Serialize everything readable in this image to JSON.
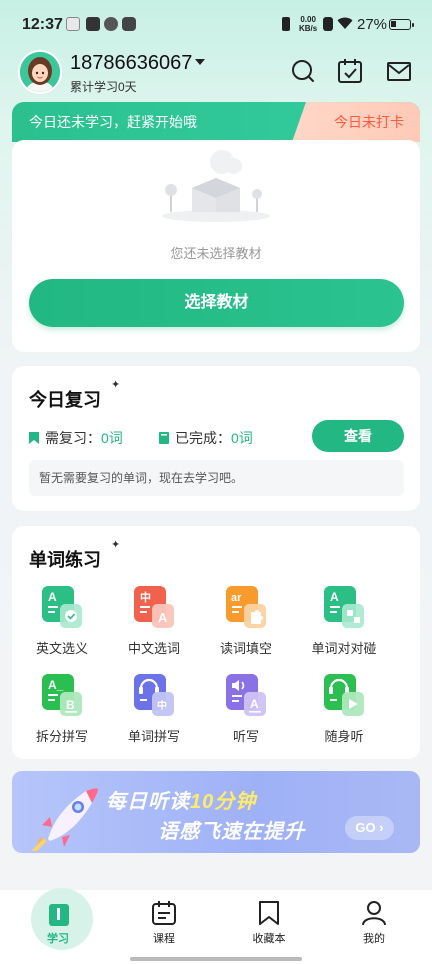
{
  "status_bar": {
    "time": "12:37",
    "net_speed_value": "0.00",
    "net_speed_unit": "KB/s",
    "battery_percent": "27%"
  },
  "header": {
    "phone": "18786636067",
    "study_days": "累计学习0天",
    "icons": [
      "search-icon",
      "calendar-check-icon",
      "mail-icon"
    ]
  },
  "textbook": {
    "banner_left": "今日还未学习，赶紧开始哦",
    "banner_right": "今日未打卡",
    "empty_text": "您还未选择教材",
    "select_button": "选择教材"
  },
  "review": {
    "title": "今日复习",
    "need_label": "需复习：",
    "need_value": "0词",
    "done_label": "已完成：",
    "done_value": "0词",
    "view_button": "查看",
    "tip": "暂无需要复习的单词，现在去学习吧。"
  },
  "practice": {
    "title": "单词练习",
    "items": [
      {
        "label": "英文选义",
        "icon": "english-choose-meaning-icon",
        "color": "#2bbf86"
      },
      {
        "label": "中文选词",
        "icon": "chinese-choose-word-icon",
        "color": "#f0624e"
      },
      {
        "label": "读词填空",
        "icon": "read-fill-blank-icon",
        "color": "#f89a2c"
      },
      {
        "label": "单词对对碰",
        "icon": "word-match-icon",
        "color": "#2bbf86"
      },
      {
        "label": "拆分拼写",
        "icon": "split-spell-icon",
        "color": "#2bbf52"
      },
      {
        "label": "单词拼写",
        "icon": "word-spell-icon",
        "color": "#6c73e8"
      },
      {
        "label": "听写",
        "icon": "dictation-icon",
        "color": "#8a72e6"
      },
      {
        "label": "随身听",
        "icon": "portable-listen-icon",
        "color": "#2bbf52"
      }
    ]
  },
  "promo": {
    "line1_prefix": "每日听读",
    "line1_highlight": "10分钟",
    "line2": "语感飞速在提升",
    "go_label": "GO"
  },
  "nav": {
    "items": [
      {
        "label": "学习",
        "icon": "book-icon",
        "active": true
      },
      {
        "label": "课程",
        "icon": "course-calendar-icon",
        "active": false
      },
      {
        "label": "收藏本",
        "icon": "bookmark-icon",
        "active": false
      },
      {
        "label": "我的",
        "icon": "user-icon",
        "active": false
      }
    ]
  },
  "colors": {
    "accent": "#22b783",
    "warning": "#ff5a3c"
  }
}
